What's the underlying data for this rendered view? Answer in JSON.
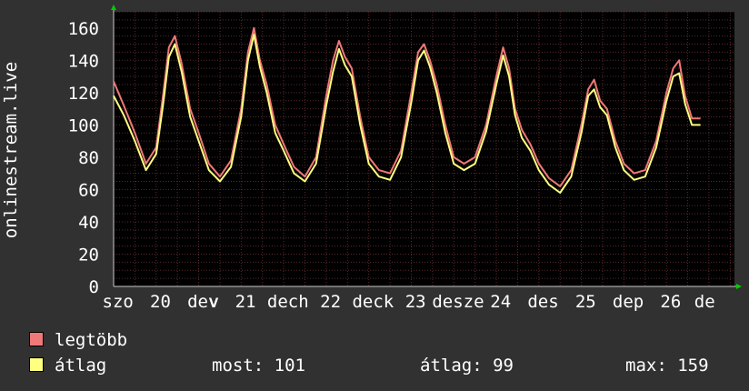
{
  "colors": {
    "background": "#313131",
    "plot_background": "#000000",
    "grid": "#5a2a2a",
    "axis": "#cccccc",
    "arrow": "#00cc00",
    "max_series": "#f07878",
    "avg_series": "#ffff80",
    "text": "#ffffff"
  },
  "legend": {
    "max_label": "legtöbb",
    "avg_label": "átlag",
    "stats": {
      "now": "most: 101",
      "avg": "átlag: 99",
      "max": "max: 159"
    }
  },
  "chart_data": {
    "type": "line",
    "ylabel": "onlinestream.live",
    "ylim": [
      0,
      170
    ],
    "yticks": [
      0,
      20,
      40,
      60,
      80,
      100,
      120,
      140,
      160
    ],
    "xlim": [
      0,
      7.3
    ],
    "xticks": [
      {
        "x": 0.05,
        "label": "szo"
      },
      {
        "x": 0.55,
        "label": "20"
      },
      {
        "x": 1.05,
        "label": "dev"
      },
      {
        "x": 1.18,
        "label": "v"
      },
      {
        "x": 1.55,
        "label": "21"
      },
      {
        "x": 2.05,
        "label": "dech"
      },
      {
        "x": 2.55,
        "label": "22"
      },
      {
        "x": 3.05,
        "label": "deck"
      },
      {
        "x": 3.55,
        "label": "23"
      },
      {
        "x": 4.05,
        "label": "desze"
      },
      {
        "x": 4.55,
        "label": "24"
      },
      {
        "x": 5.05,
        "label": "des"
      },
      {
        "x": 5.55,
        "label": "25"
      },
      {
        "x": 6.05,
        "label": "dep"
      },
      {
        "x": 6.55,
        "label": "26"
      },
      {
        "x": 6.95,
        "label": "de"
      }
    ],
    "grid": true,
    "series": [
      {
        "name": "legtöbb",
        "x": [
          0.0,
          0.12,
          0.25,
          0.38,
          0.5,
          0.58,
          0.65,
          0.72,
          0.8,
          0.9,
          1.0,
          1.12,
          1.25,
          1.38,
          1.5,
          1.58,
          1.65,
          1.72,
          1.8,
          1.9,
          2.0,
          2.12,
          2.25,
          2.38,
          2.5,
          2.58,
          2.65,
          2.72,
          2.8,
          2.9,
          3.0,
          3.12,
          3.25,
          3.38,
          3.5,
          3.58,
          3.65,
          3.72,
          3.8,
          3.9,
          4.0,
          4.12,
          4.25,
          4.38,
          4.5,
          4.58,
          4.65,
          4.72,
          4.8,
          4.9,
          5.0,
          5.12,
          5.25,
          5.38,
          5.5,
          5.58,
          5.65,
          5.72,
          5.8,
          5.9,
          6.0,
          6.12,
          6.25,
          6.38,
          6.5,
          6.58,
          6.65,
          6.72,
          6.8,
          6.9
        ],
        "y": [
          127,
          112,
          95,
          76,
          86,
          118,
          148,
          155,
          138,
          110,
          95,
          76,
          68,
          78,
          110,
          145,
          160,
          140,
          125,
          100,
          88,
          74,
          68,
          80,
          118,
          140,
          152,
          142,
          135,
          105,
          80,
          72,
          70,
          84,
          120,
          145,
          150,
          140,
          125,
          100,
          80,
          76,
          80,
          100,
          130,
          148,
          135,
          110,
          97,
          88,
          76,
          67,
          62,
          72,
          100,
          122,
          128,
          115,
          110,
          90,
          76,
          70,
          72,
          90,
          120,
          135,
          140,
          118,
          104,
          104
        ]
      },
      {
        "name": "átlag",
        "x": [
          0.0,
          0.12,
          0.25,
          0.38,
          0.5,
          0.58,
          0.65,
          0.72,
          0.8,
          0.9,
          1.0,
          1.12,
          1.25,
          1.38,
          1.5,
          1.58,
          1.65,
          1.72,
          1.8,
          1.9,
          2.0,
          2.12,
          2.25,
          2.38,
          2.5,
          2.58,
          2.65,
          2.72,
          2.8,
          2.9,
          3.0,
          3.12,
          3.25,
          3.38,
          3.5,
          3.58,
          3.65,
          3.72,
          3.8,
          3.9,
          4.0,
          4.12,
          4.25,
          4.38,
          4.5,
          4.58,
          4.65,
          4.72,
          4.8,
          4.9,
          5.0,
          5.12,
          5.25,
          5.38,
          5.5,
          5.58,
          5.65,
          5.72,
          5.8,
          5.9,
          6.0,
          6.12,
          6.25,
          6.38,
          6.5,
          6.58,
          6.65,
          6.72,
          6.8,
          6.9
        ],
        "y": [
          118,
          106,
          90,
          72,
          82,
          112,
          142,
          150,
          133,
          105,
          90,
          72,
          65,
          74,
          105,
          140,
          156,
          136,
          120,
          95,
          84,
          70,
          65,
          76,
          112,
          133,
          147,
          137,
          130,
          100,
          76,
          68,
          66,
          80,
          114,
          140,
          146,
          136,
          120,
          95,
          76,
          72,
          76,
          96,
          125,
          143,
          130,
          106,
          92,
          84,
          72,
          63,
          58,
          68,
          95,
          118,
          122,
          111,
          106,
          86,
          72,
          66,
          68,
          86,
          115,
          130,
          132,
          113,
          100,
          100
        ]
      }
    ]
  }
}
